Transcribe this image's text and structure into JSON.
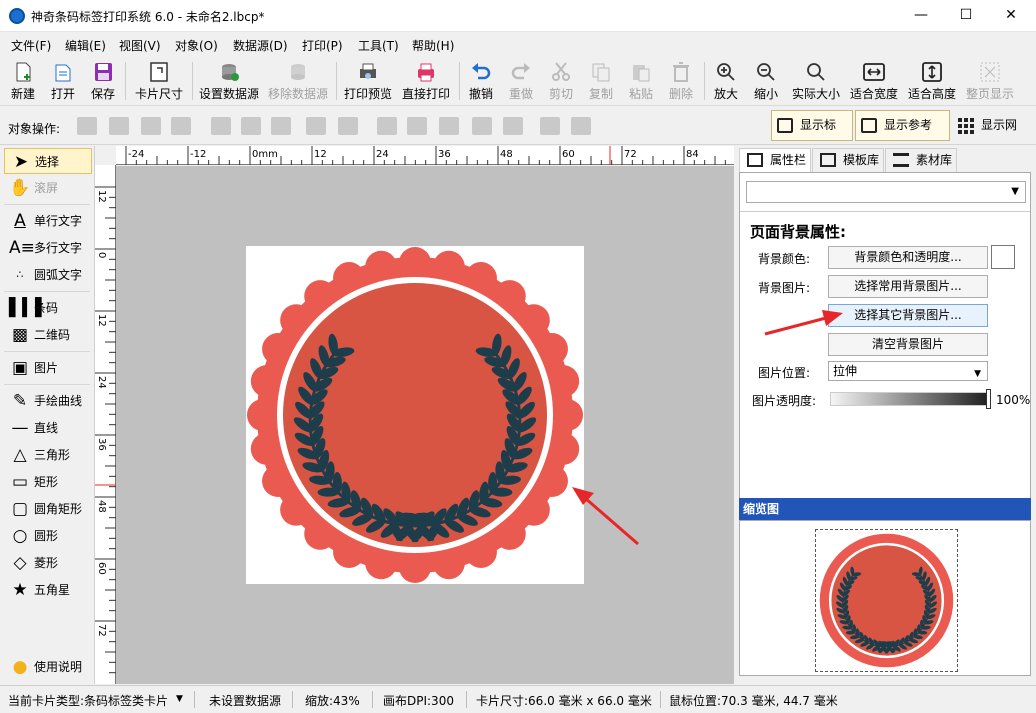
{
  "window": {
    "title": "神奇条码标签打印系统 6.0 - 未命名2.lbcp*",
    "min": "—",
    "max": "☐",
    "close": "✕"
  },
  "menu": [
    "文件(F)",
    "编辑(E)",
    "视图(V)",
    "对象(O)",
    "数据源(D)",
    "打印(P)",
    "工具(T)",
    "帮助(H)"
  ],
  "toolbar": [
    {
      "label": "新建",
      "icon": "new-file-icon",
      "enabled": true
    },
    {
      "label": "打开",
      "icon": "open-icon",
      "enabled": true
    },
    {
      "label": "保存",
      "icon": "save-icon",
      "enabled": true
    },
    {
      "label": "卡片尺寸",
      "icon": "card-size-icon",
      "enabled": true
    },
    {
      "label": "设置数据源",
      "icon": "database-icon",
      "enabled": true
    },
    {
      "label": "移除数据源",
      "icon": "remove-database-icon",
      "enabled": false
    },
    {
      "label": "打印预览",
      "icon": "print-preview-icon",
      "enabled": true
    },
    {
      "label": "直接打印",
      "icon": "printer-icon",
      "enabled": true
    },
    {
      "label": "撤销",
      "icon": "undo-icon",
      "enabled": true
    },
    {
      "label": "重做",
      "icon": "redo-icon",
      "enabled": false
    },
    {
      "label": "剪切",
      "icon": "cut-icon",
      "enabled": false
    },
    {
      "label": "复制",
      "icon": "copy-icon",
      "enabled": false
    },
    {
      "label": "粘贴",
      "icon": "paste-icon",
      "enabled": false
    },
    {
      "label": "删除",
      "icon": "delete-icon",
      "enabled": false
    },
    {
      "label": "放大",
      "icon": "zoom-in-icon",
      "enabled": true
    },
    {
      "label": "缩小",
      "icon": "zoom-out-icon",
      "enabled": true
    },
    {
      "label": "实际大小",
      "icon": "actual-size-icon",
      "enabled": true
    },
    {
      "label": "适合宽度",
      "icon": "fit-width-icon",
      "enabled": true
    },
    {
      "label": "适合高度",
      "icon": "fit-height-icon",
      "enabled": true
    },
    {
      "label": "整页显示",
      "icon": "full-page-icon",
      "enabled": false
    }
  ],
  "objbar": {
    "label": "对象操作:",
    "show_ruler": "显示标尺",
    "show_guides": "显示参考线",
    "show_grid": "显示网格"
  },
  "tools": [
    {
      "label": "选择",
      "icon": "pointer-icon",
      "selected": true,
      "enabled": true
    },
    {
      "label": "滚屏",
      "icon": "hand-icon",
      "selected": false,
      "enabled": false
    },
    {
      "label": "单行文字",
      "icon": "single-line-text-icon",
      "selected": false,
      "enabled": true
    },
    {
      "label": "多行文字",
      "icon": "multi-line-text-icon",
      "selected": false,
      "enabled": true
    },
    {
      "label": "圆弧文字",
      "icon": "arc-text-icon",
      "selected": false,
      "enabled": true
    },
    {
      "label": "条码",
      "icon": "barcode-icon",
      "selected": false,
      "enabled": true
    },
    {
      "label": "二维码",
      "icon": "qrcode-icon",
      "selected": false,
      "enabled": true
    },
    {
      "label": "图片",
      "icon": "image-icon",
      "selected": false,
      "enabled": true
    },
    {
      "label": "手绘曲线",
      "icon": "pen-icon",
      "selected": false,
      "enabled": true
    },
    {
      "label": "直线",
      "icon": "line-icon",
      "selected": false,
      "enabled": true
    },
    {
      "label": "三角形",
      "icon": "triangle-icon",
      "selected": false,
      "enabled": true
    },
    {
      "label": "矩形",
      "icon": "rectangle-icon",
      "selected": false,
      "enabled": true
    },
    {
      "label": "圆角矩形",
      "icon": "rounded-rectangle-icon",
      "selected": false,
      "enabled": true
    },
    {
      "label": "圆形",
      "icon": "circle-icon",
      "selected": false,
      "enabled": true
    },
    {
      "label": "菱形",
      "icon": "diamond-icon",
      "selected": false,
      "enabled": true
    },
    {
      "label": "五角星",
      "icon": "star-icon",
      "selected": false,
      "enabled": true
    },
    {
      "label": "使用说明",
      "icon": "lightbulb-icon",
      "selected": false,
      "enabled": true
    }
  ],
  "ruler": {
    "top": [
      "-24",
      "-12",
      "0mm",
      "12",
      "24",
      "36",
      "48",
      "60",
      "72",
      "84"
    ],
    "left": [
      "12",
      "0",
      "12",
      "24",
      "36",
      "48",
      "60",
      "72",
      "8"
    ]
  },
  "tabs": {
    "props": "属性栏",
    "templates": "模板库",
    "assets": "素材库"
  },
  "props": {
    "title": "页面背景属性:",
    "bg_color_label": "背景颜色:",
    "bg_color_btn": "背景颜色和透明度...",
    "bg_image_label": "背景图片:",
    "common_bg_btn": "选择常用背景图片...",
    "other_bg_btn": "选择其它背景图片...",
    "clear_bg_btn": "清空背景图片",
    "img_pos_label": "图片位置:",
    "img_pos_value": "拉伸",
    "img_opacity_label": "图片透明度:",
    "img_opacity_value": "100%",
    "opacity_fraction": 1.0
  },
  "thumbnail": {
    "title": "缩览图"
  },
  "status": {
    "card_type": "当前卡片类型:条码标签类卡片",
    "datasource": "未设置数据源",
    "zoom": "缩放:43%",
    "dpi": "画布DPI:300",
    "card_size": "卡片尺寸:66.0 毫米 x 66.0 毫米",
    "mouse": "鼠标位置:70.3 毫米, 44.7 毫米"
  },
  "colors": {
    "badge_outer": "#ea5a50",
    "badge_inner": "#d85443",
    "laurel": "#1e3d4a",
    "arrow": "#e8262a",
    "tb_blue": "#1f6fd0"
  }
}
